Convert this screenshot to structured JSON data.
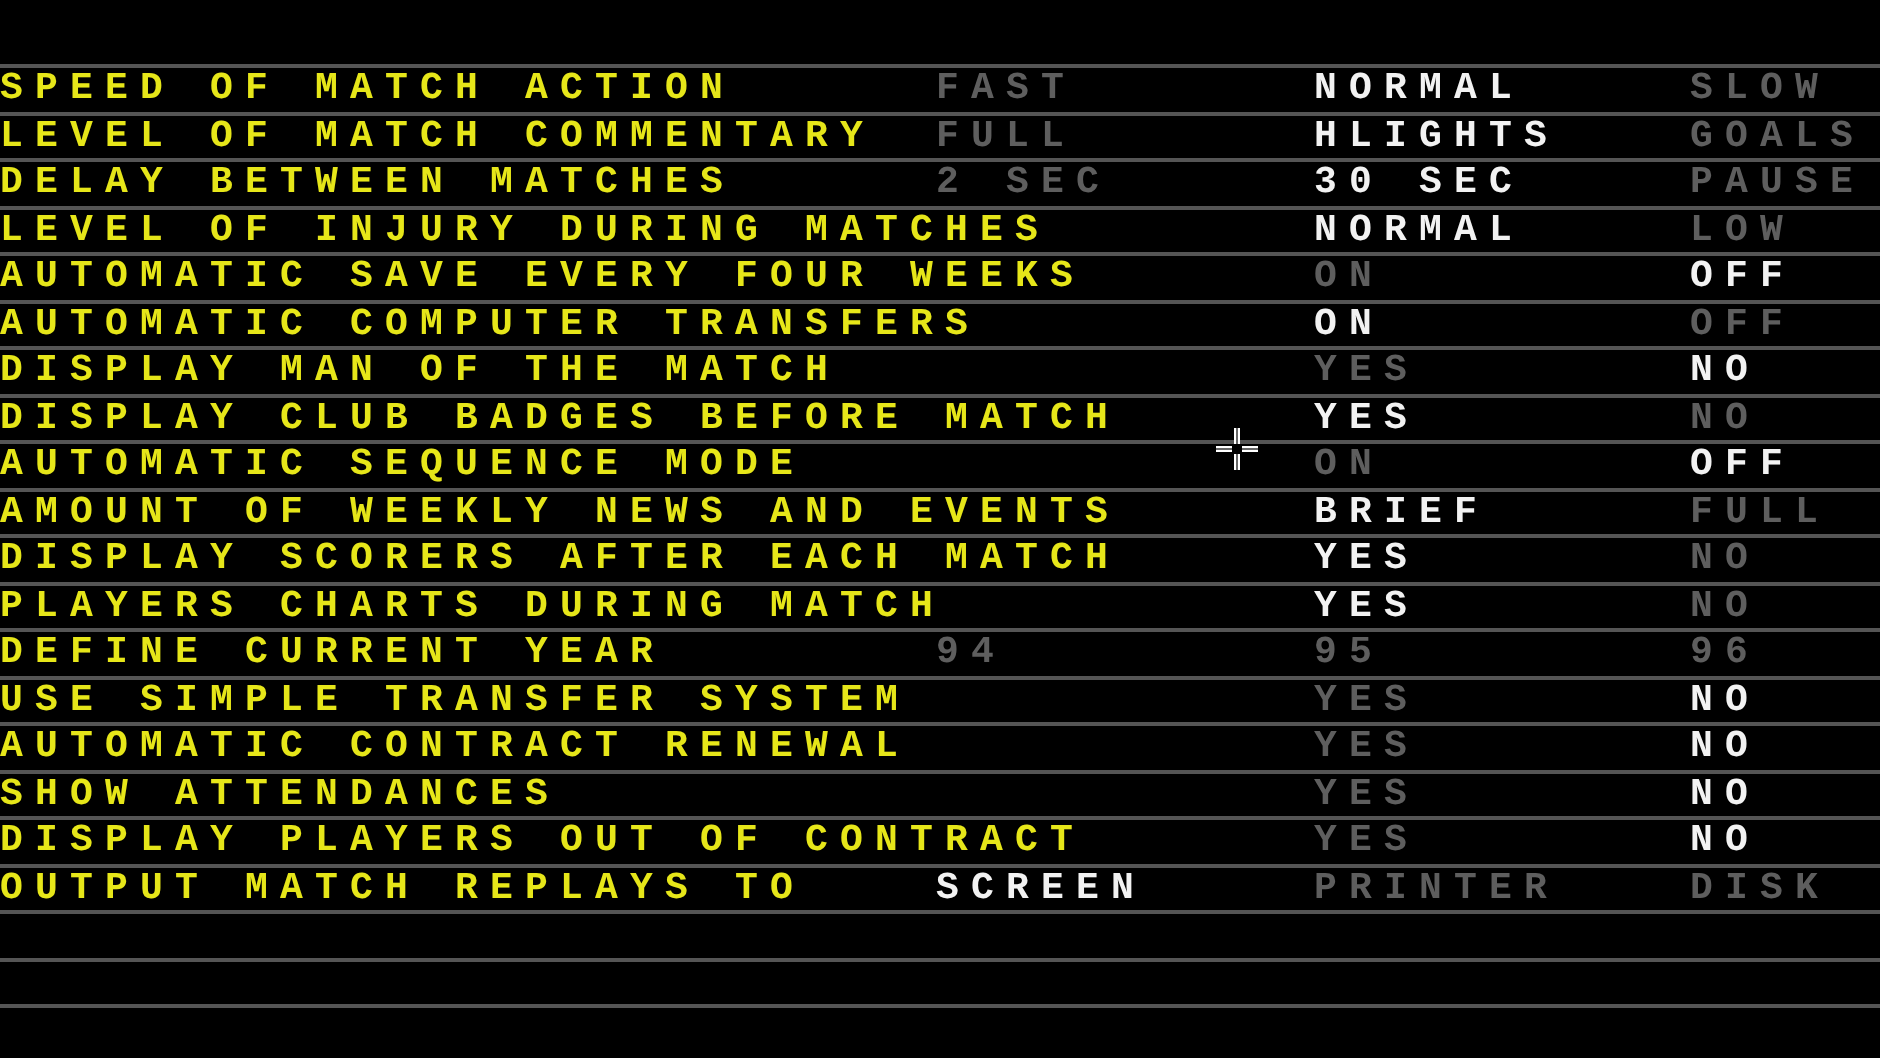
{
  "settings": [
    {
      "label": "SPEED OF MATCH ACTION",
      "column_1": {
        "text": "FAST",
        "selected": false
      },
      "column_2": {
        "text": "NORMAL",
        "selected": true
      },
      "column_3": {
        "text": "SLOW",
        "selected": false
      }
    },
    {
      "label": "LEVEL OF MATCH COMMENTARY",
      "column_1": {
        "text": "FULL",
        "selected": false
      },
      "column_2": {
        "text": "HLIGHTS",
        "selected": true
      },
      "column_3": {
        "text": "GOALS",
        "selected": false
      }
    },
    {
      "label": "DELAY BETWEEN MATCHES",
      "column_1": {
        "text": "2 SEC",
        "selected": false
      },
      "column_2": {
        "text": "30 SEC",
        "selected": true
      },
      "column_3": {
        "text": "PAUSE",
        "selected": false
      }
    },
    {
      "label": "LEVEL OF INJURY DURING MATCHES",
      "column_2": {
        "text": "NORMAL",
        "selected": true
      },
      "column_3": {
        "text": "LOW",
        "selected": false
      }
    },
    {
      "label": "AUTOMATIC SAVE EVERY FOUR WEEKS",
      "column_2": {
        "text": "ON",
        "selected": false
      },
      "column_3": {
        "text": "OFF",
        "selected": true
      }
    },
    {
      "label": "AUTOMATIC COMPUTER TRANSFERS",
      "column_2": {
        "text": "ON",
        "selected": true
      },
      "column_3": {
        "text": "OFF",
        "selected": false
      }
    },
    {
      "label": "DISPLAY MAN OF THE MATCH",
      "column_2": {
        "text": "YES",
        "selected": false
      },
      "column_3": {
        "text": "NO",
        "selected": true
      }
    },
    {
      "label": "DISPLAY CLUB BADGES BEFORE MATCH",
      "column_2": {
        "text": "YES",
        "selected": true
      },
      "column_3": {
        "text": "NO",
        "selected": false
      }
    },
    {
      "label": "AUTOMATIC SEQUENCE MODE",
      "column_2": {
        "text": "ON",
        "selected": false
      },
      "column_3": {
        "text": "OFF",
        "selected": true
      }
    },
    {
      "label": "AMOUNT OF WEEKLY NEWS AND EVENTS",
      "column_2": {
        "text": "BRIEF",
        "selected": true
      },
      "column_3": {
        "text": "FULL",
        "selected": false
      }
    },
    {
      "label": "DISPLAY SCORERS AFTER EACH MATCH",
      "column_2": {
        "text": "YES",
        "selected": true
      },
      "column_3": {
        "text": "NO",
        "selected": false
      }
    },
    {
      "label": "PLAYERS CHARTS DURING MATCH",
      "column_2": {
        "text": "YES",
        "selected": true
      },
      "column_3": {
        "text": "NO",
        "selected": false
      }
    },
    {
      "label": "DEFINE CURRENT YEAR",
      "column_1": {
        "text": "94",
        "selected": false
      },
      "column_2": {
        "text": "95",
        "selected": false
      },
      "column_3": {
        "text": "96",
        "selected": false
      }
    },
    {
      "label": "USE SIMPLE TRANSFER SYSTEM",
      "column_2": {
        "text": "YES",
        "selected": false
      },
      "column_3": {
        "text": "NO",
        "selected": true
      }
    },
    {
      "label": "AUTOMATIC CONTRACT RENEWAL",
      "column_2": {
        "text": "YES",
        "selected": false
      },
      "column_3": {
        "text": "NO",
        "selected": true
      }
    },
    {
      "label": "SHOW ATTENDANCES",
      "column_2": {
        "text": "YES",
        "selected": false
      },
      "column_3": {
        "text": "NO",
        "selected": true
      }
    },
    {
      "label": "DISPLAY PLAYERS OUT OF CONTRACT",
      "column_2": {
        "text": "YES",
        "selected": false
      },
      "column_3": {
        "text": "NO",
        "selected": true
      }
    },
    {
      "label": "OUTPUT MATCH REPLAYS TO",
      "column_1": {
        "text": "SCREEN",
        "selected": true
      },
      "column_2": {
        "text": "PRINTER",
        "selected": false
      },
      "column_3": {
        "text": "DISK",
        "selected": false
      }
    }
  ]
}
